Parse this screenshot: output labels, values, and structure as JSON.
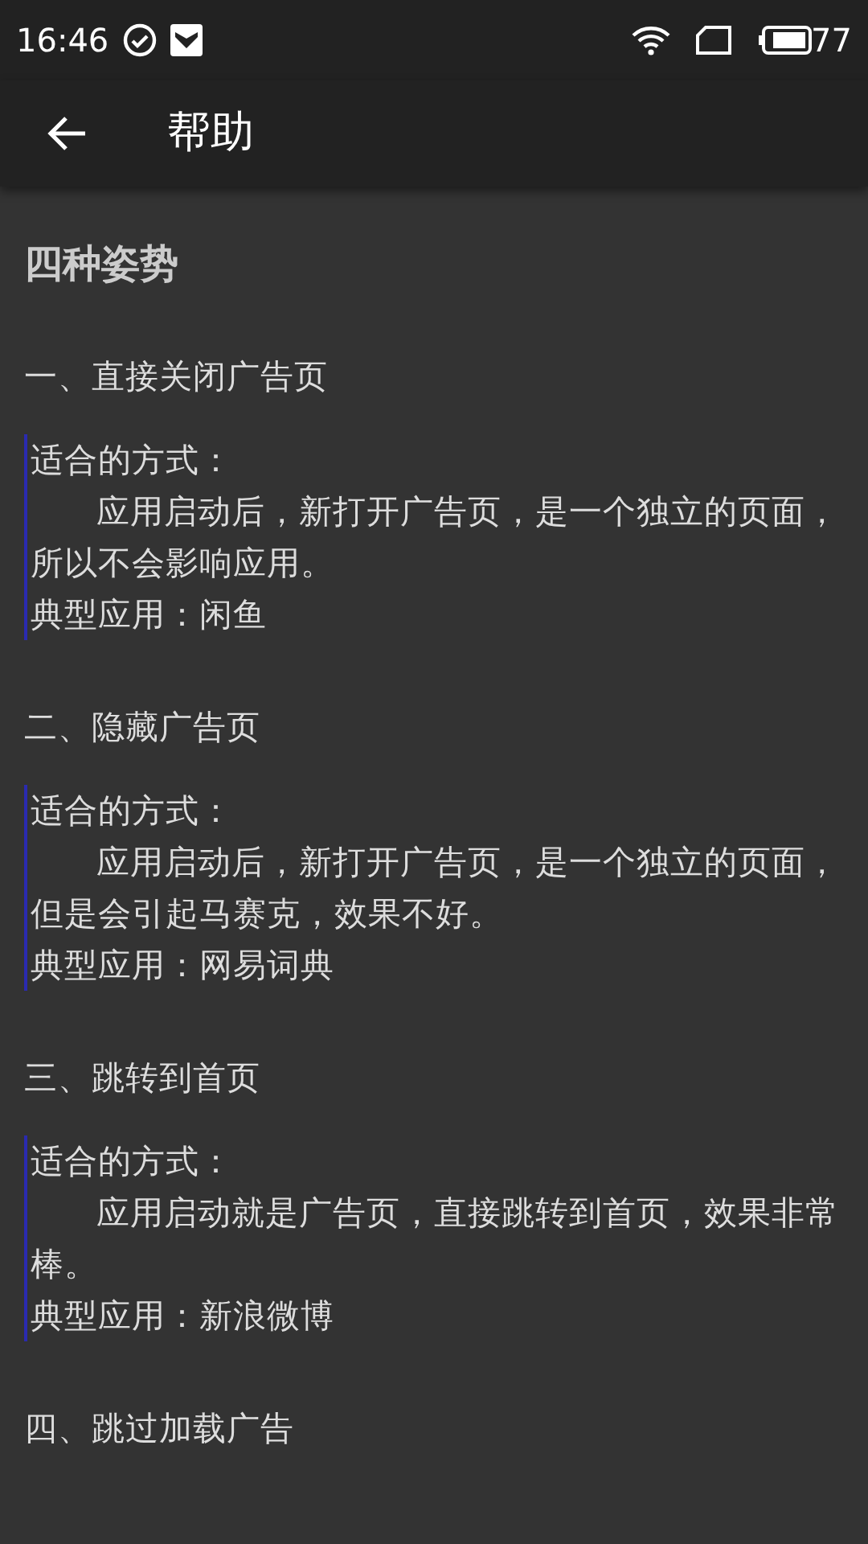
{
  "status_bar": {
    "time": "16:46",
    "battery": "77"
  },
  "app_bar": {
    "title": "帮助"
  },
  "article": {
    "title": "四种姿势",
    "sections": [
      {
        "heading": "一、直接关闭广告页",
        "quote": {
          "label": "适合的方式：",
          "body": "应用启动后，新打开广告页，是一个独立的页面，所以不会影响应用。",
          "example": "典型应用：闲鱼"
        }
      },
      {
        "heading": "二、隐藏广告页",
        "quote": {
          "label": "适合的方式：",
          "body": "应用启动后，新打开广告页，是一个独立的页面，但是会引起马赛克，效果不好。",
          "example": "典型应用：网易词典"
        }
      },
      {
        "heading": "三、跳转到首页",
        "quote": {
          "label": "适合的方式：",
          "body": "应用启动就是广告页，直接跳转到首页，效果非常棒。",
          "example": "典型应用：新浪微博"
        }
      },
      {
        "heading": "四、跳过加载广告"
      }
    ]
  }
}
